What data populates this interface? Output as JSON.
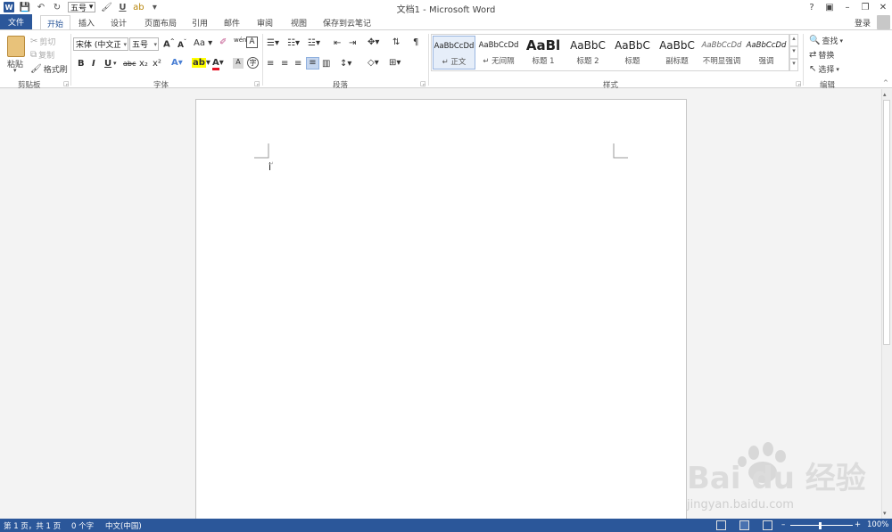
{
  "app": {
    "title": "文档1 - Microsoft Word",
    "logo_letter": "W"
  },
  "qat": {
    "font_size_value": "五号",
    "underline": "U"
  },
  "window_buttons": [
    "?",
    "▣",
    "–",
    "❐",
    "✕"
  ],
  "tabs": [
    {
      "label": "文件"
    },
    {
      "label": "开始"
    },
    {
      "label": "插入"
    },
    {
      "label": "设计"
    },
    {
      "label": "页面布局"
    },
    {
      "label": "引用"
    },
    {
      "label": "邮件"
    },
    {
      "label": "审阅"
    },
    {
      "label": "视图"
    },
    {
      "label": "保存到云笔记"
    }
  ],
  "account": {
    "login_label": "登录"
  },
  "clipboard": {
    "paste": "粘贴",
    "cut": "剪切",
    "copy": "复制",
    "format_painter": "格式刷",
    "group": "剪贴板"
  },
  "font": {
    "font_name": "宋体 (中文正文)",
    "font_size": "五号",
    "grow": "A",
    "shrink": "A",
    "change_case": "Aa",
    "phonetic": "wén",
    "bold": "B",
    "italic": "I",
    "underline": "U",
    "strike": "abc",
    "subscript": "x₂",
    "superscript": "x²",
    "font_color": "A",
    "group": "字体"
  },
  "paragraph": {
    "group": "段落"
  },
  "styles": {
    "group": "样式",
    "items": [
      {
        "preview": "AaBbCcDd",
        "name": "↵ 正文"
      },
      {
        "preview": "AaBbCcDd",
        "name": "↵ 无间隔"
      },
      {
        "preview": "AaBl",
        "name": "标题 1"
      },
      {
        "preview": "AaBbC",
        "name": "标题 2"
      },
      {
        "preview": "AaBbC",
        "name": "标题"
      },
      {
        "preview": "AaBbC",
        "name": "副标题"
      },
      {
        "preview": "AaBbCcDd",
        "name": "不明显强调"
      },
      {
        "preview": "AaBbCcDd",
        "name": "强调"
      }
    ]
  },
  "editing": {
    "find": "查找",
    "replace": "替换",
    "select": "选择",
    "group": "编辑"
  },
  "document": {
    "paragraph_mark": "↵"
  },
  "status": {
    "page": "第 1 页，共 1 页",
    "words": "0 个字",
    "language": "中文(中国)",
    "zoom": "100%",
    "zoom_minus": "–",
    "zoom_plus": "+"
  },
  "watermark": {
    "brand": "Bai du 经验",
    "url": "jingyan.baidu.com"
  },
  "colors": {
    "accent": "#2b579a",
    "highlight": "#ffff00",
    "font_red": "#e81123"
  }
}
